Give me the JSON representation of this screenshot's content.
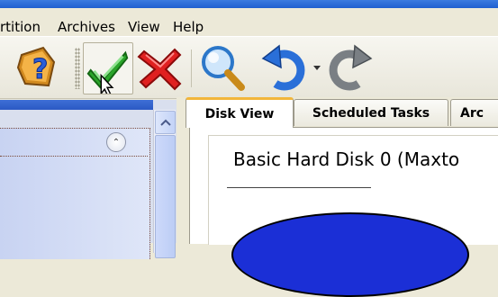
{
  "menu": {
    "items": [
      "rtition",
      "Archives",
      "View",
      "Help"
    ]
  },
  "toolbar": {
    "buttons": [
      {
        "icon": "help-icon",
        "label": "Help"
      },
      {
        "icon": "checkmark-icon",
        "label": "Apply"
      },
      {
        "icon": "cancel-x-icon",
        "label": "Cancel"
      },
      {
        "icon": "magnifier-icon",
        "label": "Search"
      },
      {
        "icon": "undo-icon",
        "label": "Undo"
      },
      {
        "icon": "redo-icon",
        "label": "Redo"
      }
    ]
  },
  "tabs": [
    {
      "label": "Disk View",
      "active": true
    },
    {
      "label": "Scheduled Tasks",
      "active": false
    },
    {
      "label": "Arc",
      "active": false
    }
  ],
  "disk_view": {
    "title": "Basic Hard Disk 0 (Maxto"
  },
  "colors": {
    "disk_fill": "#1b2fd6",
    "check_green": "#2aa52a",
    "cancel_red": "#e02020",
    "active_tab_accent": "#f2b63a"
  }
}
